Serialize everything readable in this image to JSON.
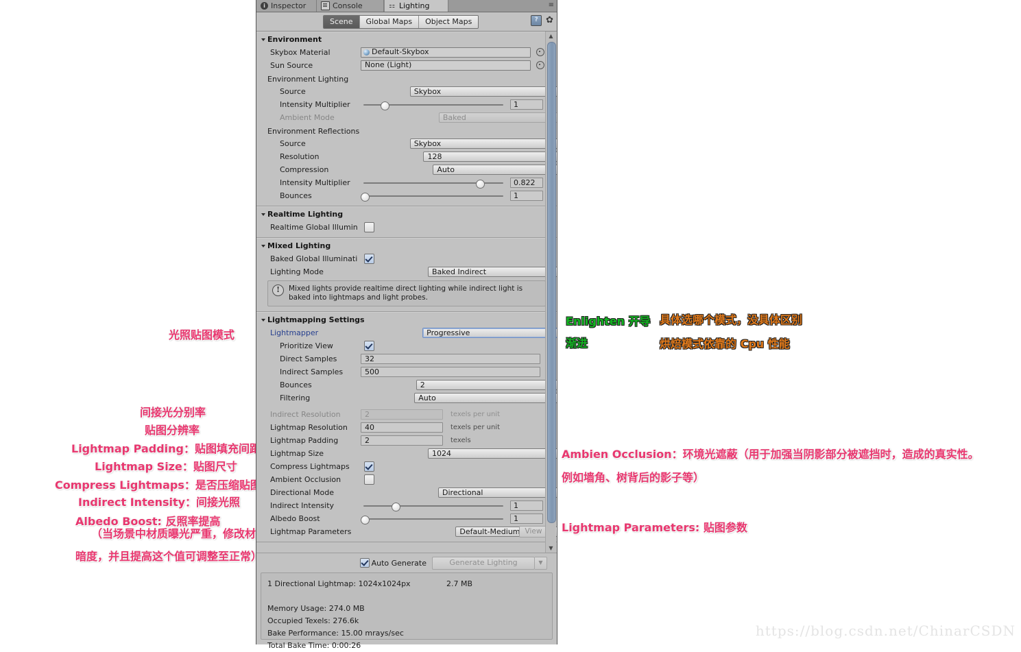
{
  "window": {
    "tabs": [
      {
        "label": "Inspector",
        "icon": "info-icon",
        "active": false
      },
      {
        "label": "Console",
        "icon": "console-icon",
        "active": false
      },
      {
        "label": "Lighting",
        "icon": "lighting-icon",
        "active": true
      }
    ],
    "menu_icon": "hamburger-menu-icon"
  },
  "toolbar": {
    "segments": [
      {
        "label": "Scene",
        "active": true
      },
      {
        "label": "Global Maps",
        "active": false
      },
      {
        "label": "Object Maps",
        "active": false
      }
    ],
    "help_icon": "help-book-icon",
    "gear_icon": "gear-icon"
  },
  "environment": {
    "title": "Environment",
    "skybox_material_label": "Skybox Material",
    "skybox_material_value": "Default-Skybox",
    "sun_source_label": "Sun Source",
    "sun_source_value": "None (Light)",
    "env_lighting_group": "Environment Lighting",
    "env_lighting_source_label": "Source",
    "env_lighting_source_value": "Skybox",
    "env_intensity_label": "Intensity Multiplier",
    "env_intensity_value": "1",
    "ambient_mode_label": "Ambient Mode",
    "ambient_mode_value": "Baked",
    "env_reflections_group": "Environment Reflections",
    "refl_source_label": "Source",
    "refl_source_value": "Skybox",
    "refl_resolution_label": "Resolution",
    "refl_resolution_value": "128",
    "refl_compression_label": "Compression",
    "refl_compression_value": "Auto",
    "refl_intensity_label": "Intensity Multiplier",
    "refl_intensity_value": "0.822",
    "refl_bounces_label": "Bounces",
    "refl_bounces_value": "1"
  },
  "realtime_lighting": {
    "title": "Realtime Lighting",
    "realtime_gi_label": "Realtime Global Illumin",
    "realtime_gi_checked": false
  },
  "mixed_lighting": {
    "title": "Mixed Lighting",
    "baked_gi_label": "Baked Global Illuminati",
    "baked_gi_checked": true,
    "lighting_mode_label": "Lighting Mode",
    "lighting_mode_value": "Baked Indirect",
    "info_icon": "warning-icon",
    "info_text": "Mixed lights provide realtime direct lighting while indirect light is baked into lightmaps and light probes."
  },
  "lightmapping": {
    "title": "Lightmapping Settings",
    "lightmapper_label": "Lightmapper",
    "lightmapper_value": "Progressive",
    "prioritize_view_label": "Prioritize View",
    "prioritize_view_checked": true,
    "direct_samples_label": "Direct Samples",
    "direct_samples_value": "32",
    "indirect_samples_label": "Indirect Samples",
    "indirect_samples_value": "500",
    "bounces_label": "Bounces",
    "bounces_value": "2",
    "filtering_label": "Filtering",
    "filtering_value": "Auto",
    "indirect_resolution_label": "Indirect Resolution",
    "indirect_resolution_value": "2",
    "indirect_resolution_unit": "texels per unit",
    "lightmap_resolution_label": "Lightmap Resolution",
    "lightmap_resolution_value": "40",
    "lightmap_resolution_unit": "texels per unit",
    "lightmap_padding_label": "Lightmap Padding",
    "lightmap_padding_value": "2",
    "lightmap_padding_unit": "texels",
    "lightmap_size_label": "Lightmap Size",
    "lightmap_size_value": "1024",
    "compress_lightmaps_label": "Compress Lightmaps",
    "compress_lightmaps_checked": true,
    "ambient_occlusion_label": "Ambient Occlusion",
    "ambient_occlusion_checked": false,
    "directional_mode_label": "Directional Mode",
    "directional_mode_value": "Directional",
    "indirect_intensity_label": "Indirect Intensity",
    "indirect_intensity_value": "1",
    "albedo_boost_label": "Albedo Boost",
    "albedo_boost_value": "1",
    "lightmap_parameters_label": "Lightmap Parameters",
    "lightmap_parameters_value": "Default-Medium",
    "view_button_label": "View"
  },
  "footer": {
    "auto_generate_label": "Auto Generate",
    "auto_generate_checked": true,
    "generate_lighting_label": "Generate Lighting",
    "generate_dropdown_icon": "chevron-down-icon"
  },
  "stats": {
    "lightmap_line": "1 Directional Lightmap: 1024x1024px",
    "lightmap_size": "2.7 MB",
    "memory_usage": "Memory Usage: 274.0 MB",
    "occupied_texels": "Occupied Texels: 276.6k",
    "bake_performance": "Bake Performance: 15.00 mrays/sec",
    "total_bake_time": "Total Bake Time: 0:00:26"
  },
  "annotations": {
    "left": {
      "lightmap_mode": "光照贴图模式",
      "indirect_res": "间接光分别率",
      "texture_res": "贴图分辨率",
      "lightmap_padding": "Lightmap Padding：贴图填充间距",
      "lightmap_size": "Lightmap Size：贴图尺寸",
      "compress_lightmaps": "Compress Lightmaps：是否压缩贴图",
      "indirect_intensity": "Indirect Intensity：间接光照",
      "albedo_boost_1": "Albedo Boost: 反照率提高",
      "albedo_boost_2": "（当场景中材质曝光严重，修改材质",
      "albedo_boost_3": "暗度，并且提高这个值可调整至正常）"
    },
    "right": {
      "enlighten": "Enlighten 开导",
      "progressive": "渐进",
      "mode_note_1": "具体选哪个模式，没具体区别",
      "mode_note_2": "烘焙模式依靠的 Cpu 性能",
      "ambient_occlusion_1": "Ambien Occlusion：环境光遮蔽（用于加强当阴影部分被遮挡时，造成的真实性。",
      "ambient_occlusion_2": "例如墙角、树背后的影子等）",
      "lightmap_parameters": "Lightmap Parameters: 贴图参数"
    }
  },
  "watermark": "https://blog.csdn.net/ChinarCSDN",
  "colors": {
    "panel_bg": "#c2c2c2",
    "pink": "#e8376f",
    "green": "#12b521",
    "orange": "#e0791a"
  }
}
